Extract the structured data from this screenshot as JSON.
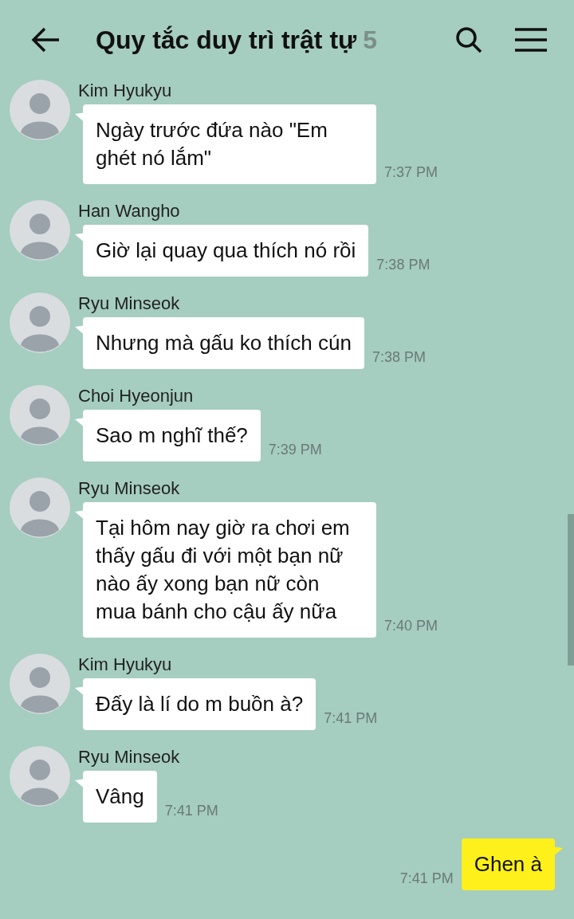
{
  "header": {
    "title": "Quy tắc duy trì trật tự",
    "member_count": "5"
  },
  "messages": [
    {
      "kind": "received",
      "sender": "Kim Hyukyu",
      "text": "Ngày trước đứa nào \"Em ghét nó lắm\"",
      "time": "7:37 PM"
    },
    {
      "kind": "received",
      "sender": "Han Wangho",
      "text": "Giờ lại quay qua thích nó rồi",
      "time": "7:38 PM"
    },
    {
      "kind": "received",
      "sender": "Ryu Minseok",
      "text": "Nhưng mà gấu ko thích cún",
      "time": "7:38 PM"
    },
    {
      "kind": "received",
      "sender": "Choi Hyeonjun",
      "text": "Sao m nghĩ thế?",
      "time": "7:39 PM"
    },
    {
      "kind": "received",
      "sender": "Ryu Minseok",
      "text": "Tại hôm nay giờ ra chơi em thấy gấu đi với một bạn nữ nào ấy xong bạn nữ còn mua bánh cho cậu ấy nữa",
      "time": "7:40 PM"
    },
    {
      "kind": "received",
      "sender": "Kim Hyukyu",
      "text": "Đấy là lí do m buồn à?",
      "time": "7:41 PM"
    },
    {
      "kind": "received",
      "sender": "Ryu Minseok",
      "text": "Vâng",
      "time": "7:41 PM"
    },
    {
      "kind": "sent",
      "text": "Ghen à",
      "time": "7:41 PM"
    }
  ]
}
